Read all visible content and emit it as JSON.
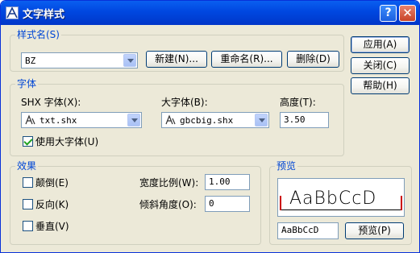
{
  "window": {
    "title": "文字样式"
  },
  "style_name": {
    "group_label": "样式名(S)",
    "combo_value": "BZ",
    "new_button": "新建(N)...",
    "rename_button": "重命名(R)...",
    "delete_button": "删除(D)"
  },
  "actions": {
    "apply": "应用(A)",
    "close": "关闭(C)",
    "help": "帮助(H)"
  },
  "font": {
    "group_label": "字体",
    "shx_label": "SHX 字体(X):",
    "shx_value": "txt.shx",
    "bigfont_label": "大字体(B):",
    "bigfont_value": "gbcbig.shx",
    "height_label": "高度(T):",
    "height_value": "3.50",
    "use_bigfont_label": "使用大字体(U)",
    "use_bigfont_checked": true
  },
  "effects": {
    "group_label": "效果",
    "upside_down": "颠倒(E)",
    "backwards": "反向(K)",
    "vertical": "垂直(V)",
    "width_factor_label": "宽度比例(W):",
    "width_factor_value": "1.00",
    "oblique_label": "倾斜角度(O):",
    "oblique_value": "0"
  },
  "preview": {
    "group_label": "预览",
    "sample_text": "AaBbCcD",
    "input_value": "AaBbCcD",
    "button": "预览(P)"
  },
  "colors": {
    "title_bar": "#0054e3",
    "group_label": "#0046d5",
    "dialog_bg": "#ece9d8"
  }
}
